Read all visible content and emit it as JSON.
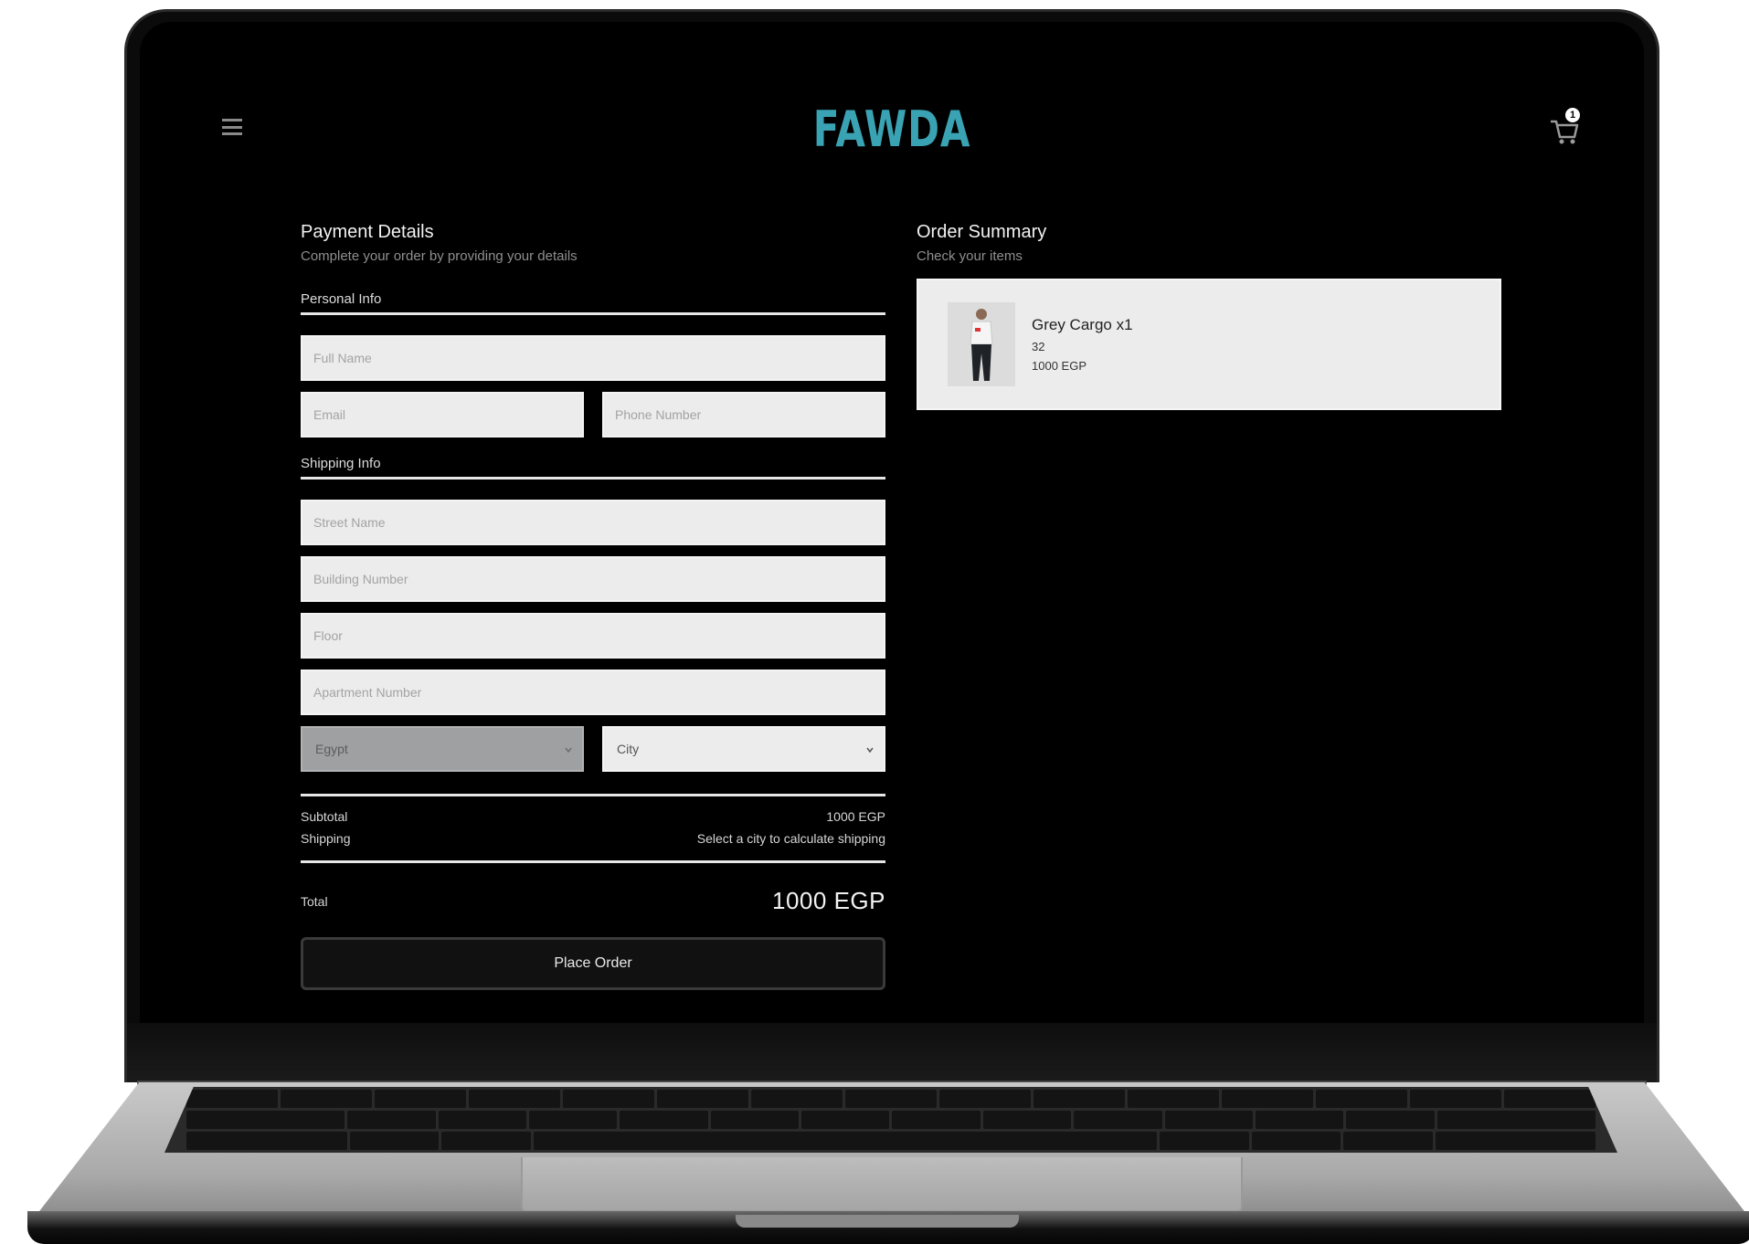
{
  "brand": {
    "name": "FAWDA",
    "color": "#3aa3b3"
  },
  "header": {
    "menu_icon": "hamburger-icon",
    "cart_icon": "shopping-cart-icon",
    "cart_count": "1"
  },
  "payment": {
    "title": "Payment Details",
    "subtitle": "Complete your order by providing your details",
    "personal_info": {
      "heading": "Personal Info",
      "full_name_placeholder": "Full Name",
      "email_placeholder": "Email",
      "phone_placeholder": "Phone Number"
    },
    "shipping_info": {
      "heading": "Shipping Info",
      "street_placeholder": "Street Name",
      "building_placeholder": "Building Number",
      "floor_placeholder": "Floor",
      "apartment_placeholder": "Apartment Number",
      "country_value": "Egypt",
      "city_value": "City"
    },
    "totals": {
      "subtotal_label": "Subtotal",
      "subtotal_value": "1000 EGP",
      "shipping_label": "Shipping",
      "shipping_value": "Select a city to calculate shipping",
      "total_label": "Total",
      "total_value": "1000 EGP"
    },
    "place_order_label": "Place Order"
  },
  "summary": {
    "title": "Order Summary",
    "subtitle": "Check your items",
    "items": [
      {
        "name": "Grey Cargo x1",
        "size": "32",
        "price": "1000 EGP",
        "thumb_icon": "product-photo-icon"
      }
    ]
  }
}
